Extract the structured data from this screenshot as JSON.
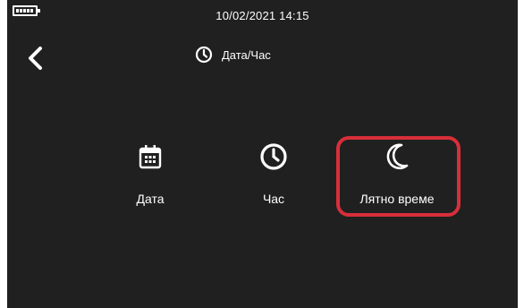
{
  "status_bar": {
    "datetime": "10/02/2021  14:15",
    "battery_icon": "battery-full-icon"
  },
  "header": {
    "back_icon": "chevron-left-icon",
    "title_icon": "clock-icon",
    "title": "Дата/Час"
  },
  "options": [
    {
      "icon": "calendar-icon",
      "label": "Дата"
    },
    {
      "icon": "clock-icon",
      "label": "Час"
    },
    {
      "icon": "moon-icon",
      "label": "Лятно време",
      "highlighted": true
    }
  ],
  "colors": {
    "background": "#202020",
    "foreground": "#ffffff",
    "highlight": "#d72f3a"
  }
}
